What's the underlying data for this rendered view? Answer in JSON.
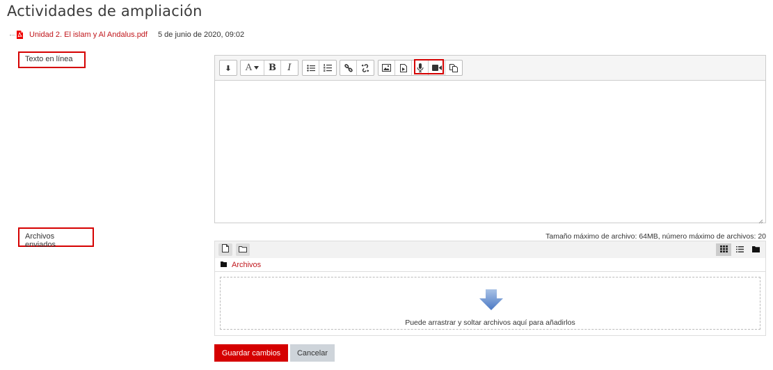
{
  "page": {
    "title": "Actividades de ampliación"
  },
  "file": {
    "name": "Unidad 2. El islam y Al Andalus.pdf",
    "date": "5 de junio de 2020, 09:02"
  },
  "online_text": {
    "label": "Texto en línea"
  },
  "editor": {
    "toolbar": [
      {
        "group": "collapse",
        "buttons": [
          "toggle-icon"
        ]
      },
      {
        "group": "style",
        "buttons": [
          "font-style-icon",
          "bold-icon",
          "italic-icon"
        ]
      },
      {
        "group": "list",
        "buttons": [
          "unordered-list-icon",
          "ordered-list-icon"
        ]
      },
      {
        "group": "links",
        "buttons": [
          "link-icon",
          "unlink-icon"
        ]
      },
      {
        "group": "files",
        "buttons": [
          "image-icon",
          "media-icon",
          "record-audio-icon",
          "record-video-icon",
          "manage-files-icon"
        ]
      }
    ],
    "bold_glyph": "B",
    "italic_glyph": "I",
    "font_glyph": "A",
    "content": ""
  },
  "submitted_files": {
    "label": "Archivos enviados",
    "limits": "Tamaño máximo de archivo: 64MB, número máximo de archivos: 20",
    "folder": "Archivos",
    "drop_text": "Puede arrastrar y soltar archivos aquí para añadirlos",
    "view_modes": [
      "grid-view-icon",
      "list-view-icon",
      "tree-view-icon"
    ],
    "active_view": "grid-view-icon"
  },
  "actions": {
    "save": "Guardar cambios",
    "cancel": "Cancelar"
  },
  "colors": {
    "accent": "#d50000",
    "link": "#c0161b",
    "cancel_bg": "#ced4da"
  }
}
